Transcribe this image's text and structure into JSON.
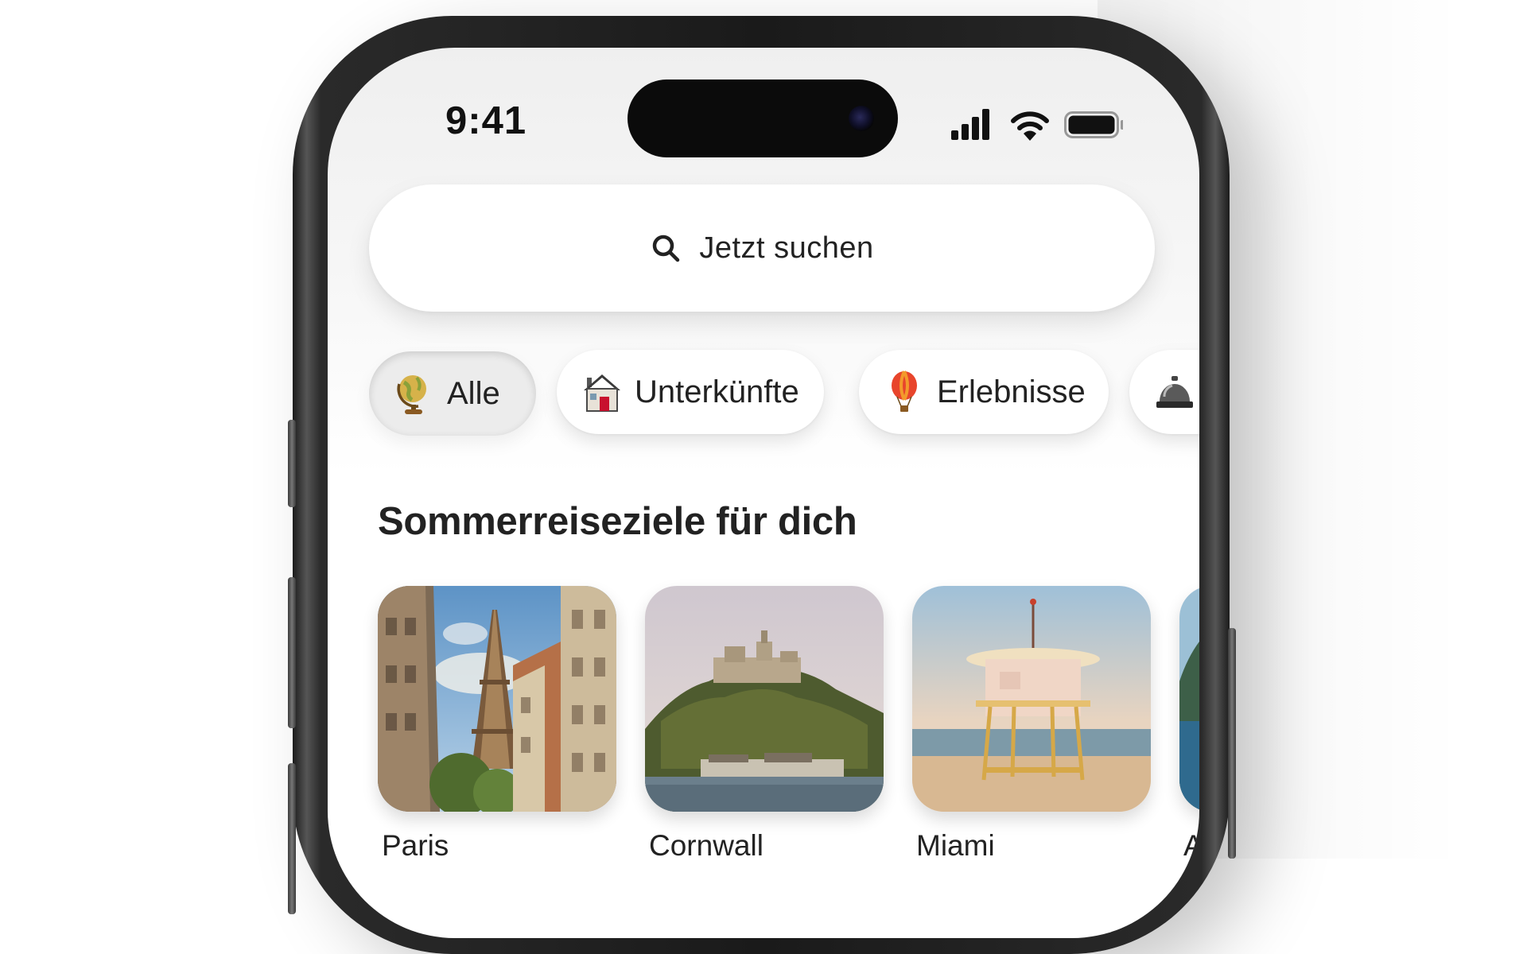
{
  "status_bar": {
    "time": "9:41",
    "icons": [
      "signal-icon",
      "wifi-icon",
      "battery-icon"
    ]
  },
  "search": {
    "label": "Jetzt suchen",
    "icon": "search-icon"
  },
  "categories": [
    {
      "label": "Alle",
      "icon": "globe-icon",
      "selected": true
    },
    {
      "label": "Unterkünfte",
      "icon": "house-icon",
      "selected": false
    },
    {
      "label": "Erlebnisse",
      "icon": "hot-air-balloon-icon",
      "selected": false
    },
    {
      "label": "",
      "icon": "service-bell-icon",
      "selected": false
    }
  ],
  "section": {
    "title": "Sommerreiseziele für dich"
  },
  "destinations": [
    {
      "name": "Paris"
    },
    {
      "name": "Cornwall"
    },
    {
      "name": "Miami"
    },
    {
      "name": "A"
    }
  ],
  "colors": {
    "text": "#222222",
    "chip_selected_bg": "#ececec",
    "screen_bg": "#f4f4f4"
  }
}
